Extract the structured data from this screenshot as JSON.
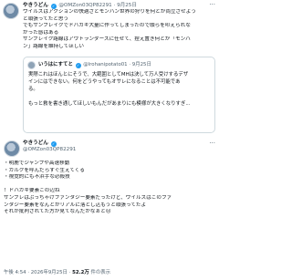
{
  "post1": {
    "name": "やきうどん",
    "handle": "@OMZon03QP82291",
    "date": "9月25日",
    "more": "···",
    "lines": [
      "ワイルズはアクションの快適さとモンハン世界の狩りを何とか両立させよう",
      "と頑張ってたと思う",
      "でもサンブレイクでドハガキ大量に作ってしまったので頭らを叩えられな",
      "かった感はある",
      "サンブレイク路線はアウトランダーズに任せて、捏え置き何とか「モンハ",
      "ン」路線を維持してほしい"
    ],
    "quote": {
      "name": "いうはにすてと",
      "handle": "@lrohanipotato01",
      "date": "9月25日",
      "lines": [
        "実際これはほんとにそうで、大範囲としてMHは決して万人受けするデザ",
        "インにはできない。何をどうやってもオサレになることは不可能であ",
        "る。",
        "",
        "もっと救を書き通してほしいもんだがあまりにも模様が大きくなりすぎ..."
      ]
    }
  },
  "post2": {
    "name": "やきうどん",
    "handle": "@OMZon03QP82291",
    "more": "···",
    "lines": [
      "・明鹿でジャンプや高速移動",
      "・ガルクを呼んだらすぐ生えてくる",
      "・視覚的にも不浜手な必殺技",
      "",
      "！ドハガキ要素この辺ね",
      "サンブレはぶっちゃけファンタジー要素だったけど、ワイルズはこのファ",
      "ンタジー要素をなんとかリアルに落とし込もうと頑張ってたよ",
      "それが批判されてた方が見てなんだかなぁと😐"
    ],
    "time": "午後 4:54 · 2026年9月25日",
    "views_count": "52.2万",
    "views_label": "件の表示"
  }
}
